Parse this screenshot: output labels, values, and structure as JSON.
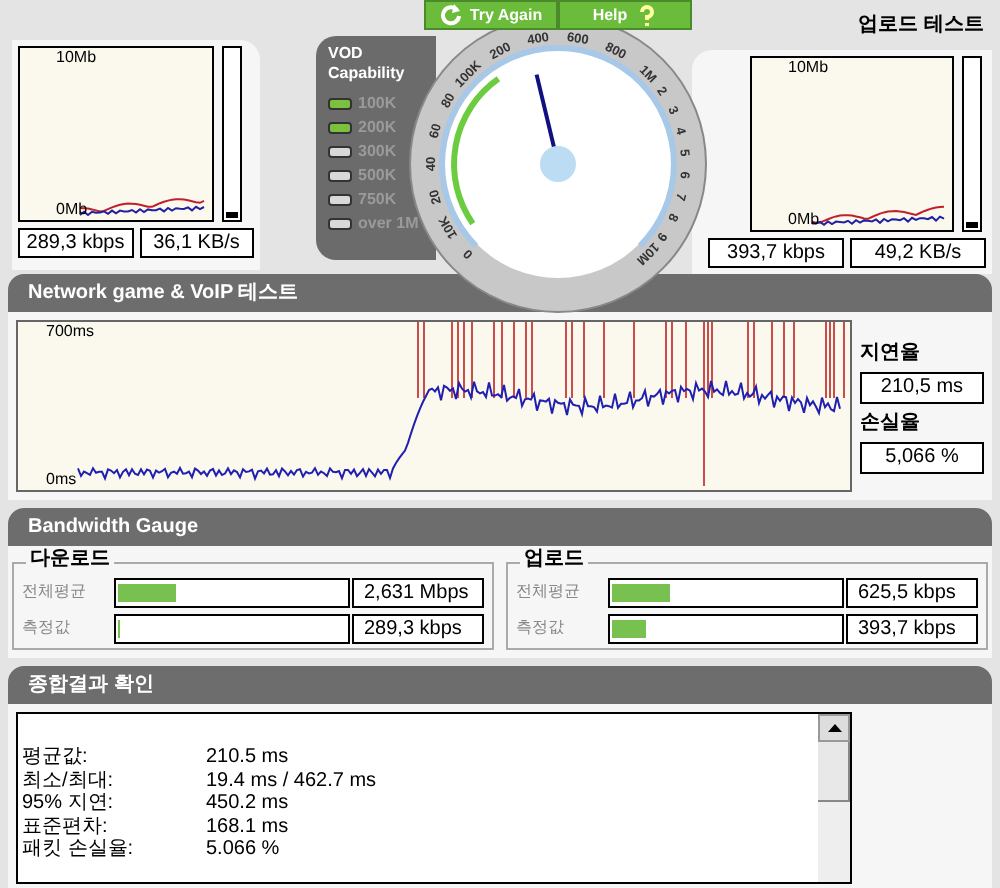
{
  "download_test": {
    "axis_top": "10Mb",
    "axis_bottom": "0Mb",
    "meter": {
      "level": 0.04
    },
    "readouts": [
      "289,3 kbps",
      "36,1 KB/s"
    ]
  },
  "vod": {
    "title": "VOD Capability",
    "items": [
      {
        "label": "100K",
        "on": true
      },
      {
        "label": "200K",
        "on": true
      },
      {
        "label": "300K",
        "on": false
      },
      {
        "label": "500K",
        "on": false
      },
      {
        "label": "750K",
        "on": false
      },
      {
        "label": "over 1M",
        "on": false
      }
    ]
  },
  "gauge": {
    "buttons": [
      {
        "label": "Try Again",
        "kind": "retry"
      },
      {
        "label": "Help",
        "kind": "help"
      }
    ],
    "dial_labels": [
      "0",
      "10K",
      "20",
      "40",
      "60",
      "80",
      "100K",
      "200",
      "400",
      "600",
      "800",
      "1M",
      "2",
      "3",
      "4",
      "5",
      "6",
      "7",
      "8",
      "9",
      "10M"
    ],
    "needle": {
      "level": 0.45
    }
  },
  "upload_test": {
    "title": "업로드 테스트",
    "axis_top": "10Mb",
    "axis_bottom": "0Mb",
    "meter": {
      "level": 0.04
    },
    "readouts": [
      "393,7 kbps",
      "49,2 KB/s"
    ]
  },
  "latency_section": {
    "title": "Network game & VoIP 테스트",
    "axis_top": "700ms",
    "axis_bottom": "0ms",
    "delay_label": "지연율",
    "delay_value": "210,5 ms",
    "loss_label": "손실율",
    "loss_value": "5,066 %"
  },
  "bandwidth_section": {
    "title": "Bandwidth Gauge",
    "groups": [
      {
        "title": "다운로드",
        "rows": [
          {
            "label": "전체평균",
            "level": 0.25,
            "value": "2,631 Mbps"
          },
          {
            "label": "측정값",
            "level": 0.01,
            "value": "289,3 kbps"
          }
        ]
      },
      {
        "title": "업로드",
        "rows": [
          {
            "label": "전체평균",
            "level": 0.25,
            "value": "625,5 kbps"
          },
          {
            "label": "측정값",
            "level": 0.15,
            "value": "393,7 kbps"
          }
        ]
      }
    ]
  },
  "summary_section": {
    "title": "종합결과 확인",
    "lines": [
      {
        "label": "평균값:",
        "value": "210.5 ms"
      },
      {
        "label": "최소/최대:",
        "value": "19.4 ms / 462.7 ms"
      },
      {
        "label": "95% 지연:",
        "value": "450.2 ms"
      },
      {
        "label": "표준편차:",
        "value": "168.1 ms"
      },
      {
        "label": "패킷 손실율:",
        "value": "5.066 %"
      }
    ]
  }
}
